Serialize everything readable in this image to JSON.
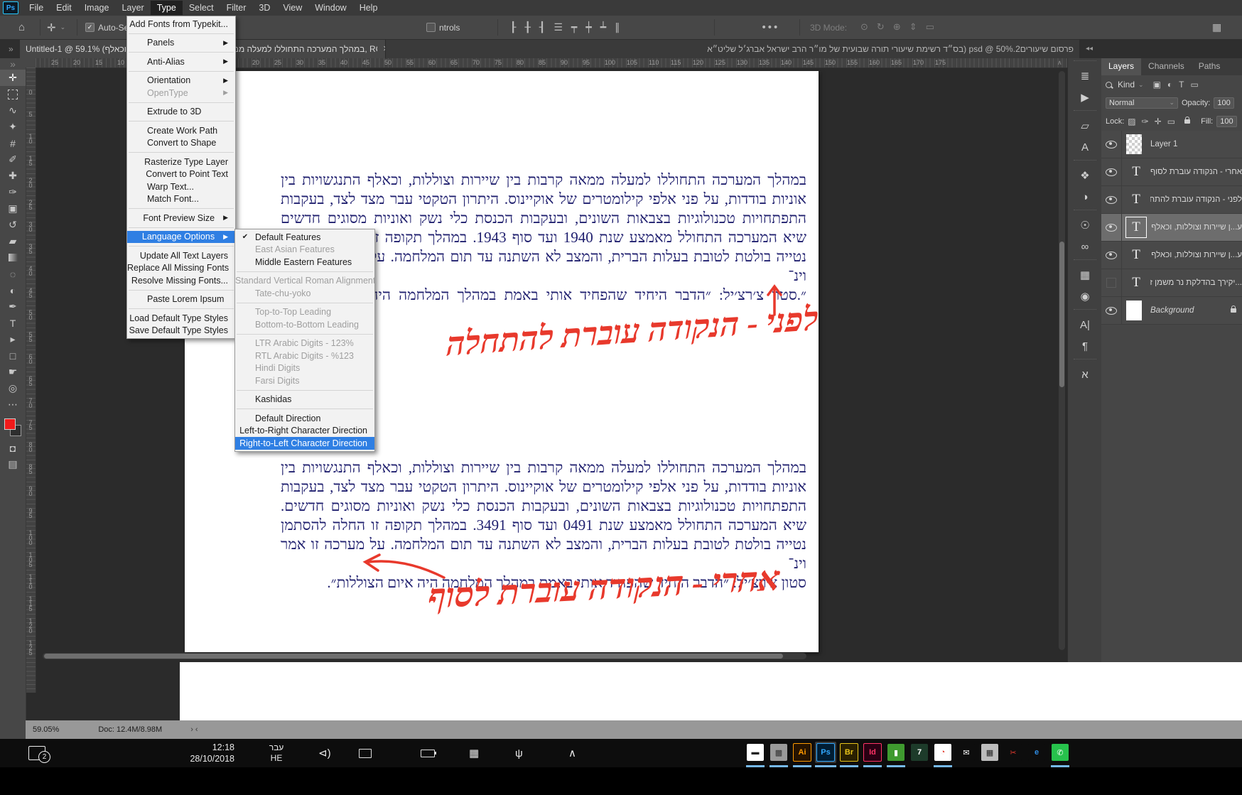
{
  "menubar": {
    "logo": "Ps",
    "items": [
      "File",
      "Edit",
      "Image",
      "Layer",
      "Type",
      "Select",
      "Filter",
      "3D",
      "View",
      "Window",
      "Help"
    ],
    "active_item": "Type"
  },
  "options_bar": {
    "home_icon": "⌂",
    "tool_icon": "✛",
    "auto_select_label": "Auto-Select:",
    "transform_label": "ntrols",
    "ellipsis": "•••",
    "mode_label": "3D Mode:",
    "align_icons": [
      {
        "name": "align-left-icon",
        "glyph": "┠"
      },
      {
        "name": "align-center-h-icon",
        "glyph": "╂"
      },
      {
        "name": "align-right-icon",
        "glyph": "┨"
      },
      {
        "name": "distribute-icon",
        "glyph": "☰"
      },
      {
        "name": "align-top-icon",
        "glyph": "┯"
      },
      {
        "name": "align-middle-icon",
        "glyph": "┿"
      },
      {
        "name": "align-bottom-icon",
        "glyph": "┷"
      },
      {
        "name": "align-vertical-icon",
        "glyph": "‖"
      }
    ],
    "mode_icons": [
      {
        "name": "3d-orbit-icon",
        "glyph": "⊙"
      },
      {
        "name": "3d-roll-icon",
        "glyph": "↻"
      },
      {
        "name": "3d-pan-icon",
        "glyph": "⊕"
      },
      {
        "name": "3d-slide-icon",
        "glyph": "⇕"
      },
      {
        "name": "3d-camera-icon",
        "glyph": "▭"
      }
    ],
    "workspace_icon": "▦"
  },
  "tabs": {
    "tab1": {
      "title": "Untitled-1 @ 59.1% (במהלך המערכה התחוללו למעלה ממאה קרבות בין שיירות וצוללות, וכאלף, RGB/8) *",
      "close": "✕",
      "active": true
    },
    "tab2": {
      "title": "פרסום שיעורים2.psd @ 50% (בס״ד רשימת שיעורי תורה שבועית של מו״ר  הרב ישראל אברג׳ל שליט״א",
      "active": false
    },
    "overflow_icon": "»",
    "collapse_icon": "◂◂"
  },
  "type_menu": {
    "items": [
      {
        "label": "Add Fonts from Typekit..."
      },
      {
        "sep": true
      },
      {
        "label": "Panels",
        "arrow": true
      },
      {
        "sep": true
      },
      {
        "label": "Anti-Alias",
        "arrow": true
      },
      {
        "sep": true
      },
      {
        "label": "Orientation",
        "arrow": true
      },
      {
        "label": "OpenType",
        "arrow": true,
        "disabled": true
      },
      {
        "sep": true
      },
      {
        "label": "Extrude to 3D"
      },
      {
        "sep": true
      },
      {
        "label": "Create Work Path"
      },
      {
        "label": "Convert to Shape"
      },
      {
        "sep": true
      },
      {
        "label": "Rasterize Type Layer"
      },
      {
        "label": "Convert to Point Text"
      },
      {
        "label": "Warp Text..."
      },
      {
        "label": "Match Font..."
      },
      {
        "sep": true
      },
      {
        "label": "Font Preview Size",
        "arrow": true
      },
      {
        "sep": true
      },
      {
        "label": "Language Options",
        "arrow": true,
        "highlight": true
      },
      {
        "sep": true
      },
      {
        "label": "Update All Text Layers"
      },
      {
        "label": "Replace All Missing Fonts"
      },
      {
        "label": "Resolve Missing Fonts..."
      },
      {
        "sep": true
      },
      {
        "label": "Paste Lorem Ipsum"
      },
      {
        "sep": true
      },
      {
        "label": "Load Default Type Styles"
      },
      {
        "label": "Save Default Type Styles"
      }
    ]
  },
  "language_menu": {
    "items": [
      {
        "label": "Default Features",
        "checked": true
      },
      {
        "label": "East Asian Features",
        "disabled": true
      },
      {
        "label": "Middle Eastern Features"
      },
      {
        "sep": true
      },
      {
        "label": "Standard Vertical Roman Alignment",
        "disabled": true
      },
      {
        "label": "Tate-chu-yoko",
        "disabled": true
      },
      {
        "sep": true
      },
      {
        "label": "Top-to-Top Leading",
        "disabled": true
      },
      {
        "label": "Bottom-to-Bottom Leading",
        "disabled": true
      },
      {
        "sep": true
      },
      {
        "label": "LTR Arabic Digits - 123%",
        "disabled": true
      },
      {
        "label": "RTL Arabic Digits - %123",
        "disabled": true
      },
      {
        "label": "Hindi Digits",
        "disabled": true
      },
      {
        "label": "Farsi Digits",
        "disabled": true
      },
      {
        "sep": true
      },
      {
        "label": "Kashidas"
      },
      {
        "sep": true
      },
      {
        "label": "Default Direction"
      },
      {
        "label": "Left-to-Right Character Direction"
      },
      {
        "label": "Right-to-Left Character Direction",
        "highlight": true
      }
    ]
  },
  "canvas": {
    "text_color": "#20206f",
    "annotation_color": "#e8392c",
    "paragraph_before": {
      "lines": [
        "במהלך המערכה התחוללו למעלה ממאה קרבות בין שיירות וצוללות, וכאלף התנגשויות בין",
        "אוניות בודדות, על פני אלפי קילומטרים של אוקיינוס. היתרון הטקטי עבר מצד לצד, בעקבות",
        "התפתחויות טכנולוגיות בצבאות השונים, ובעקבות הכנסת כלי נשק ואוניות מסוגים חדשים",
        "שיא המערכה התחולל מאמצע שנת 1940 ועד סוף 1943. במהלך תקופה זו החלה להסתמן",
        "נטייה בולטת לטובת בעלות הברית, והמצב לא השתנה עד תום המלחמה. על מערכה זו אמר וינ־",
        "״.סטון צ׳רצ׳יל: ״הדבר היחיד שהפחיד אותי באמת במהלך המלחמה היה איום הצוללות"
      ]
    },
    "paragraph_after": {
      "lines": [
        "במהלך המערכה התחוללו למעלה ממאה קרבות בין שיירות וצוללות, וכאלף התנגשויות בין",
        "אוניות בודדות, על פני אלפי קילומטרים של אוקיינוס. היתרון הטקטי עבר מצד לצד, בעקבות",
        "התפתחויות טכנולוגיות בצבאות השונים, ובעקבות הכנסת כלי נשק ואוניות מסוגים חדשים.",
        "שיא המערכה התחולל מאמצע שנת 0491 ועד סוף 3491. במהלך תקופה זו החלה להסתמן",
        "נטייה בולטת לטובת בעלות הברית, והמצב לא השתנה עד תום המלחמה. על מערכה זו אמר וינ־",
        "סטון צ׳רצ׳יל: ״הדבר היחיד שהפחיד אותי באמת במהלך המלחמה היה איום הצוללות״."
      ]
    },
    "annotation_before": "לפני - הנקודה עוברת להתחלה",
    "annotation_after": "אחרי - הנקודה עוברת לסוף"
  },
  "rulers": {
    "h_left_values": [
      25,
      20,
      15,
      10
    ],
    "h_main": {
      "from": 20,
      "to": 175,
      "step": 5
    },
    "v_main": {
      "from": 0,
      "to": 125,
      "step": 5
    },
    "scroll_arrow": "∧"
  },
  "toolbar": {
    "overflow_icon": "»",
    "tools": [
      {
        "name": "move-tool",
        "glyph": "✛",
        "selected": true
      },
      {
        "name": "marquee-tool",
        "glyph": "css-marquee"
      },
      {
        "name": "lasso-tool",
        "glyph": "∿"
      },
      {
        "name": "quick-selection-tool",
        "glyph": "✦"
      },
      {
        "name": "crop-tool",
        "glyph": "#"
      },
      {
        "name": "eyedropper-tool",
        "glyph": "✐"
      },
      {
        "name": "healing-brush-tool",
        "glyph": "✚"
      },
      {
        "name": "brush-tool",
        "glyph": "✑"
      },
      {
        "name": "clone-stamp-tool",
        "glyph": "▣"
      },
      {
        "name": "history-brush-tool",
        "glyph": "↺"
      },
      {
        "name": "eraser-tool",
        "glyph": "▰"
      },
      {
        "name": "gradient-tool",
        "glyph": "css-gradient"
      },
      {
        "name": "blur-tool",
        "glyph": "◌"
      },
      {
        "name": "dodge-tool",
        "glyph": "◐"
      },
      {
        "name": "pen-tool",
        "glyph": "✒"
      },
      {
        "name": "type-tool",
        "glyph": "T"
      },
      {
        "name": "path-selection-tool",
        "glyph": "▸"
      },
      {
        "name": "shape-tool",
        "glyph": "□"
      },
      {
        "name": "hand-tool",
        "glyph": "☛"
      },
      {
        "name": "zoom-tool",
        "glyph": "◎"
      }
    ],
    "ellipsis": "⋯",
    "foreground_color": "#f01a1a",
    "background_color": "#2e2e2e",
    "quick_mask_icon": "◘",
    "screen_mode_icon": "▤"
  },
  "dock_strip": {
    "icons": [
      {
        "name": "brush-settings-icon",
        "glyph": "≣"
      },
      {
        "name": "actions-play-icon",
        "glyph": "▶"
      },
      {
        "name": "clone-source-icon",
        "glyph": "▱"
      },
      {
        "name": "character-styles-icon",
        "glyph": "A"
      },
      {
        "name": "3d-panel-icon",
        "glyph": "❖"
      },
      {
        "name": "adjustments-icon",
        "glyph": "◑"
      },
      {
        "name": "tips-icon",
        "glyph": "☉"
      },
      {
        "name": "creative-cloud-icon",
        "glyph": "∞"
      },
      {
        "name": "swatches-icon",
        "glyph": "▦"
      },
      {
        "name": "color-panel-icon",
        "glyph": "◉"
      },
      {
        "name": "character-panel-icon",
        "glyph": "A|"
      },
      {
        "name": "paragraph-panel-icon",
        "glyph": "¶"
      },
      {
        "name": "glyphs-panel-icon",
        "glyph": "א"
      }
    ]
  },
  "layers_panel": {
    "tabs": [
      "Layers",
      "Channels",
      "Paths"
    ],
    "active_tab": "Layers",
    "kind_label": "Kind",
    "filter_icons": [
      {
        "name": "filter-pixel-icon",
        "glyph": "▣"
      },
      {
        "name": "filter-adjustment-icon",
        "glyph": "◐"
      },
      {
        "name": "filter-type-icon",
        "glyph": "T"
      },
      {
        "name": "filter-shape-icon",
        "glyph": "▭"
      }
    ],
    "blend_mode": "Normal",
    "opacity_label": "Opacity:",
    "opacity_value": "100",
    "lock_label": "Lock:",
    "lock_icons": [
      {
        "name": "lock-transparency-icon",
        "glyph": "▨"
      },
      {
        "name": "lock-pixels-icon",
        "glyph": "✑"
      },
      {
        "name": "lock-position-icon",
        "glyph": "✛"
      },
      {
        "name": "lock-artboard-icon",
        "glyph": "▭"
      }
    ],
    "fill_label": "Fill:",
    "fill_value": "100",
    "layers": [
      {
        "name": "Layer 1",
        "type": "pixel",
        "visible": true
      },
      {
        "name": "אחרי - הנקודה עוברת לסוף",
        "type": "text",
        "visible": true
      },
      {
        "name": "לפני - הנקודה עוברת להתחלה",
        "type": "text",
        "visible": true
      },
      {
        "name": "ע...ן שיירות וצוללות, וכאלף",
        "type": "text",
        "visible": true,
        "selected": true
      },
      {
        "name": "ע...ן שיירות וצוללות, וכאלף",
        "type": "text",
        "visible": true
      },
      {
        "name": "...יקירך בהדלקת נר משמן זי",
        "type": "text",
        "visible": false
      },
      {
        "name": "Background",
        "type": "background",
        "visible": true,
        "locked": true
      }
    ]
  },
  "status_bar": {
    "zoom": "59.05%",
    "doc": "Doc: 12.4M/8.98M",
    "arrows": "› ‹"
  },
  "taskbar": {
    "notification_badge": "2",
    "time": "12:18",
    "date": "28/10/2018",
    "lang_top": "עבר",
    "lang_bottom": "HE",
    "tray_icons": [
      {
        "name": "volume-icon",
        "glyph": "⊲)"
      },
      {
        "name": "network-icon",
        "glyph": "css-monitor"
      },
      {
        "name": "battery-icon",
        "glyph": "css-battery"
      },
      {
        "name": "touch-keyboard-icon",
        "glyph": "▦"
      },
      {
        "name": "usb-icon",
        "glyph": "ψ"
      },
      {
        "name": "tray-chevron-icon",
        "glyph": "∧"
      }
    ],
    "apps": [
      {
        "name": "app-movie-maker",
        "label": "▬",
        "bg": "#ffffff",
        "fg": "#222222",
        "running": true
      },
      {
        "name": "app-utility",
        "label": "▩",
        "bg": "#9a9a9a",
        "fg": "#333333",
        "running": true
      },
      {
        "name": "app-illustrator",
        "label": "Ai",
        "bg": "#261300",
        "fg": "#ff9a00",
        "running": true
      },
      {
        "name": "app-photoshop",
        "label": "Ps",
        "bg": "#001d34",
        "fg": "#31a8ff",
        "running": true,
        "active": true
      },
      {
        "name": "app-bridge",
        "label": "Br",
        "bg": "#2a2000",
        "fg": "#e8c41a",
        "running": true
      },
      {
        "name": "app-indesign",
        "label": "Id",
        "bg": "#2a0013",
        "fg": "#ff3366",
        "running": true
      },
      {
        "name": "app-coreldraw",
        "label": "▮",
        "bg": "#3f9a2f",
        "fg": "#ffffff",
        "running": true
      },
      {
        "name": "app-photos",
        "label": "7",
        "bg": "#1d3b2a",
        "fg": "#ffffff",
        "running": false
      },
      {
        "name": "app-chrome",
        "label": "◔",
        "bg": "#ffffff",
        "fg": "#e33b2e",
        "running": true
      },
      {
        "name": "app-mail",
        "label": "✉",
        "bg": "#0d0d0d",
        "fg": "#ffffff",
        "running": false
      },
      {
        "name": "app-calculator",
        "label": "▦",
        "bg": "#bcbcbc",
        "fg": "#222222",
        "running": false
      },
      {
        "name": "app-snipping",
        "label": "✂",
        "bg": "#0d0d0d",
        "fg": "#e23a2e",
        "running": false
      },
      {
        "name": "app-edge",
        "label": "e",
        "bg": "#0d0d0d",
        "fg": "#2f8de4",
        "running": false
      },
      {
        "name": "app-whatsapp",
        "label": "✆",
        "bg": "#27c24c",
        "fg": "#ffffff",
        "running": true
      }
    ]
  }
}
